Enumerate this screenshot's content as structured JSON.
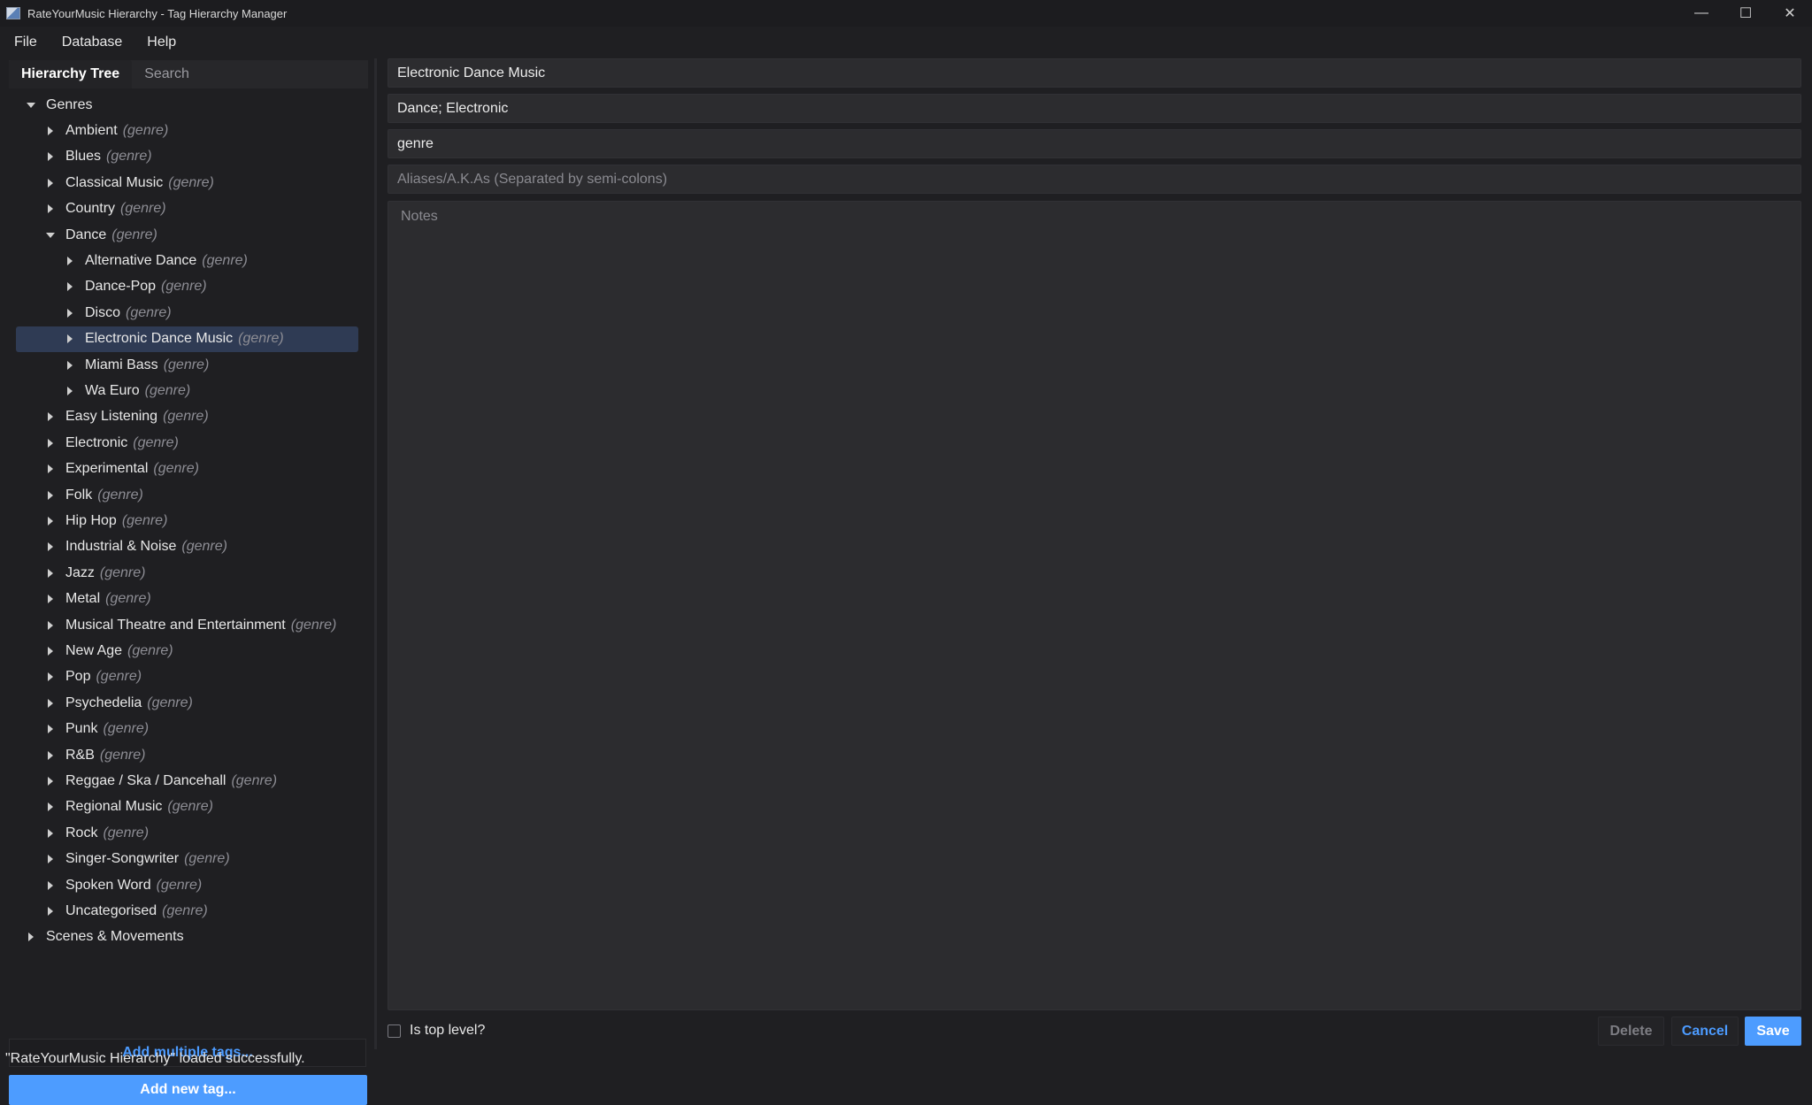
{
  "window": {
    "title": "RateYourMusic Hierarchy - Tag Hierarchy Manager",
    "controls": {
      "minimize": "—",
      "maximize": "☐",
      "close": "✕"
    }
  },
  "menu": {
    "file": "File",
    "database": "Database",
    "help": "Help"
  },
  "tabs": {
    "hierarchy": "Hierarchy Tree",
    "search": "Search"
  },
  "tree": [
    {
      "label": "Genres",
      "suffix": "",
      "level": 0,
      "expanded": true,
      "selected": false
    },
    {
      "label": "Ambient",
      "suffix": "(genre)",
      "level": 1,
      "expanded": false,
      "selected": false
    },
    {
      "label": "Blues",
      "suffix": "(genre)",
      "level": 1,
      "expanded": false,
      "selected": false
    },
    {
      "label": "Classical Music",
      "suffix": "(genre)",
      "level": 1,
      "expanded": false,
      "selected": false
    },
    {
      "label": "Country",
      "suffix": "(genre)",
      "level": 1,
      "expanded": false,
      "selected": false
    },
    {
      "label": "Dance",
      "suffix": "(genre)",
      "level": 1,
      "expanded": true,
      "selected": false
    },
    {
      "label": "Alternative Dance",
      "suffix": "(genre)",
      "level": 2,
      "expanded": false,
      "selected": false
    },
    {
      "label": "Dance-Pop",
      "suffix": "(genre)",
      "level": 2,
      "expanded": false,
      "selected": false
    },
    {
      "label": "Disco",
      "suffix": "(genre)",
      "level": 2,
      "expanded": false,
      "selected": false
    },
    {
      "label": "Electronic Dance Music",
      "suffix": "(genre)",
      "level": 2,
      "expanded": false,
      "selected": true
    },
    {
      "label": "Miami Bass",
      "suffix": "(genre)",
      "level": 2,
      "expanded": false,
      "selected": false
    },
    {
      "label": "Wa Euro",
      "suffix": "(genre)",
      "level": 2,
      "expanded": false,
      "selected": false
    },
    {
      "label": "Easy Listening",
      "suffix": "(genre)",
      "level": 1,
      "expanded": false,
      "selected": false
    },
    {
      "label": "Electronic",
      "suffix": "(genre)",
      "level": 1,
      "expanded": false,
      "selected": false
    },
    {
      "label": "Experimental",
      "suffix": "(genre)",
      "level": 1,
      "expanded": false,
      "selected": false
    },
    {
      "label": "Folk",
      "suffix": "(genre)",
      "level": 1,
      "expanded": false,
      "selected": false
    },
    {
      "label": "Hip Hop",
      "suffix": "(genre)",
      "level": 1,
      "expanded": false,
      "selected": false
    },
    {
      "label": "Industrial & Noise",
      "suffix": "(genre)",
      "level": 1,
      "expanded": false,
      "selected": false
    },
    {
      "label": "Jazz",
      "suffix": "(genre)",
      "level": 1,
      "expanded": false,
      "selected": false
    },
    {
      "label": "Metal",
      "suffix": "(genre)",
      "level": 1,
      "expanded": false,
      "selected": false
    },
    {
      "label": "Musical Theatre and Entertainment",
      "suffix": "(genre)",
      "level": 1,
      "expanded": false,
      "selected": false
    },
    {
      "label": "New Age",
      "suffix": "(genre)",
      "level": 1,
      "expanded": false,
      "selected": false
    },
    {
      "label": "Pop",
      "suffix": "(genre)",
      "level": 1,
      "expanded": false,
      "selected": false
    },
    {
      "label": "Psychedelia",
      "suffix": "(genre)",
      "level": 1,
      "expanded": false,
      "selected": false
    },
    {
      "label": "Punk",
      "suffix": "(genre)",
      "level": 1,
      "expanded": false,
      "selected": false
    },
    {
      "label": "R&B",
      "suffix": "(genre)",
      "level": 1,
      "expanded": false,
      "selected": false
    },
    {
      "label": "Reggae / Ska / Dancehall",
      "suffix": "(genre)",
      "level": 1,
      "expanded": false,
      "selected": false
    },
    {
      "label": "Regional Music",
      "suffix": "(genre)",
      "level": 1,
      "expanded": false,
      "selected": false
    },
    {
      "label": "Rock",
      "suffix": "(genre)",
      "level": 1,
      "expanded": false,
      "selected": false
    },
    {
      "label": "Singer-Songwriter",
      "suffix": "(genre)",
      "level": 1,
      "expanded": false,
      "selected": false
    },
    {
      "label": "Spoken Word",
      "suffix": "(genre)",
      "level": 1,
      "expanded": false,
      "selected": false
    },
    {
      "label": "Uncategorised",
      "suffix": "(genre)",
      "level": 1,
      "expanded": false,
      "selected": false
    },
    {
      "label": "Scenes & Movements",
      "suffix": "",
      "level": 0,
      "expanded": false,
      "selected": false
    }
  ],
  "left_buttons": {
    "add_multiple": "Add multiple tags...",
    "add_new": "Add new tag..."
  },
  "status": "\"RateYourMusic Hierarchy\" loaded successfully.",
  "editor": {
    "name_value": "Electronic Dance Music",
    "parents_value": "Dance; Electronic",
    "type_value": "genre",
    "aliases_value": "",
    "aliases_placeholder": "Aliases/A.K.As (Separated by semi-colons)",
    "notes_value": "",
    "notes_placeholder": "Notes",
    "is_top_level_label": "Is top level?",
    "is_top_level": false,
    "delete_label": "Delete",
    "cancel_label": "Cancel",
    "save_label": "Save"
  },
  "colors": {
    "accent": "#4d9cff",
    "background": "#1f1f22",
    "selected_row": "#2f3b54",
    "field_bg": "#2c2c2f"
  }
}
